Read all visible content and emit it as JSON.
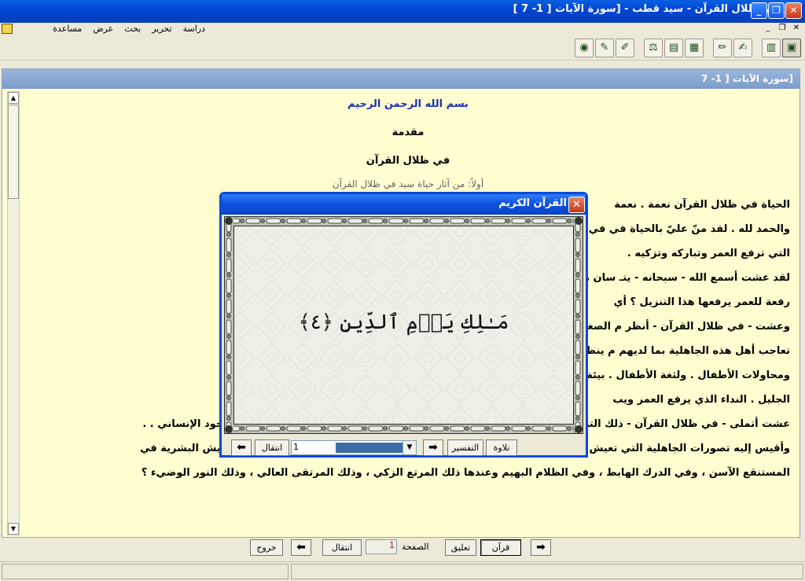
{
  "window": {
    "title": "[في ظلال القرآن - سيد قطب - [سورة الآيات [ 1- 7 ]"
  },
  "menu": [
    "دراسة",
    "تحرير",
    "بحث",
    "عرض",
    "مساعدة"
  ],
  "child_window": {
    "title": "[سورة الآيات [ 1- 7"
  },
  "document": {
    "centered": [
      "بسم الله الرحمن الرحيم",
      "مقدمة",
      "في ظلال القرآن"
    ],
    "faded_line": "أولاً: من آثار حياة سيد في ظلال القرآن",
    "paragraphs": [
      "الحياة في ظلال القرآن نعمة . نعمة",
      "والحمد لله . لقد منّ عليّ بالحياة في                                                                                              في حياتي . ذقت فيها هذه النعمة",
      "التي ترفع العمر وتباركه وتزكيه .",
      "لقد عشت أسمع الله - سبحانه - يتـ                                                                                                   سان هذا التكريم العلوي الجليل ؟ أي",
      "رفعة للعمر يرفعها هذا التنزيل ؟ أي",
      "وعشت - في ظلال القرآن - أنظر م                                                                                                    الصغيرة الهزيلة . أنظر إلى",
      "تعاجب أهل هذه الجاهلية بما لديهم م                                                                                                ينظر الكبير إلى عبث الأطفال ،",
      "ومحاولات الأطفال . ولثغة الأطفال .                                                                                                 بيئة ، ولا يسمعون النداء العلوي",
      "الجليل . النداء الذي يرفع العمر ويب",
      "عشت أتملى - في ظلال القرآن - ذلك التصور الكامل الشامل الرفيع النظيف للوجود . . لغاية الوجود كله ، وغاية الوجود الإنساني . .",
      "وأقيس إليه تصورات الجاهلية التي تعيش فيها البشرية ، في شرق وغرب ، وفي شمال وجنوب . . وأسأل . . كيف تعيش البشرية في",
      "المستنقع الآسن ، وفي الدرك الهابط ، وفي الظلام البهيم وعندها ذلك المرتع الزكي ، وذلك المرتقى العالي ، وذلك النور الوضيء ؟"
    ]
  },
  "bottom_nav": {
    "quran_label": "قرآن",
    "comment_label": "تعليق",
    "page_label": "الصفحة",
    "page_value": "1",
    "go_label": "انتقال",
    "exit_label": "خروج"
  },
  "dialog": {
    "title": "القرآن الكريم",
    "aya_text": "مَـٰلِكِ يَوۡمِ ٱلدِّينِ ﴿٤﴾",
    "aya_select_value": "1",
    "go_label": "انتقال",
    "tafsir_label": "التفسير",
    "recite_label": "تلاوة"
  },
  "toolbar_icons": [
    "book-open-icon",
    "books-icon",
    "notes-icon",
    "pencil-edit-icon",
    "grid-table-icon",
    "cabinet-icon",
    "scale-icon",
    "quran-pen-icon",
    "search-pen-icon",
    "globe-icon"
  ]
}
